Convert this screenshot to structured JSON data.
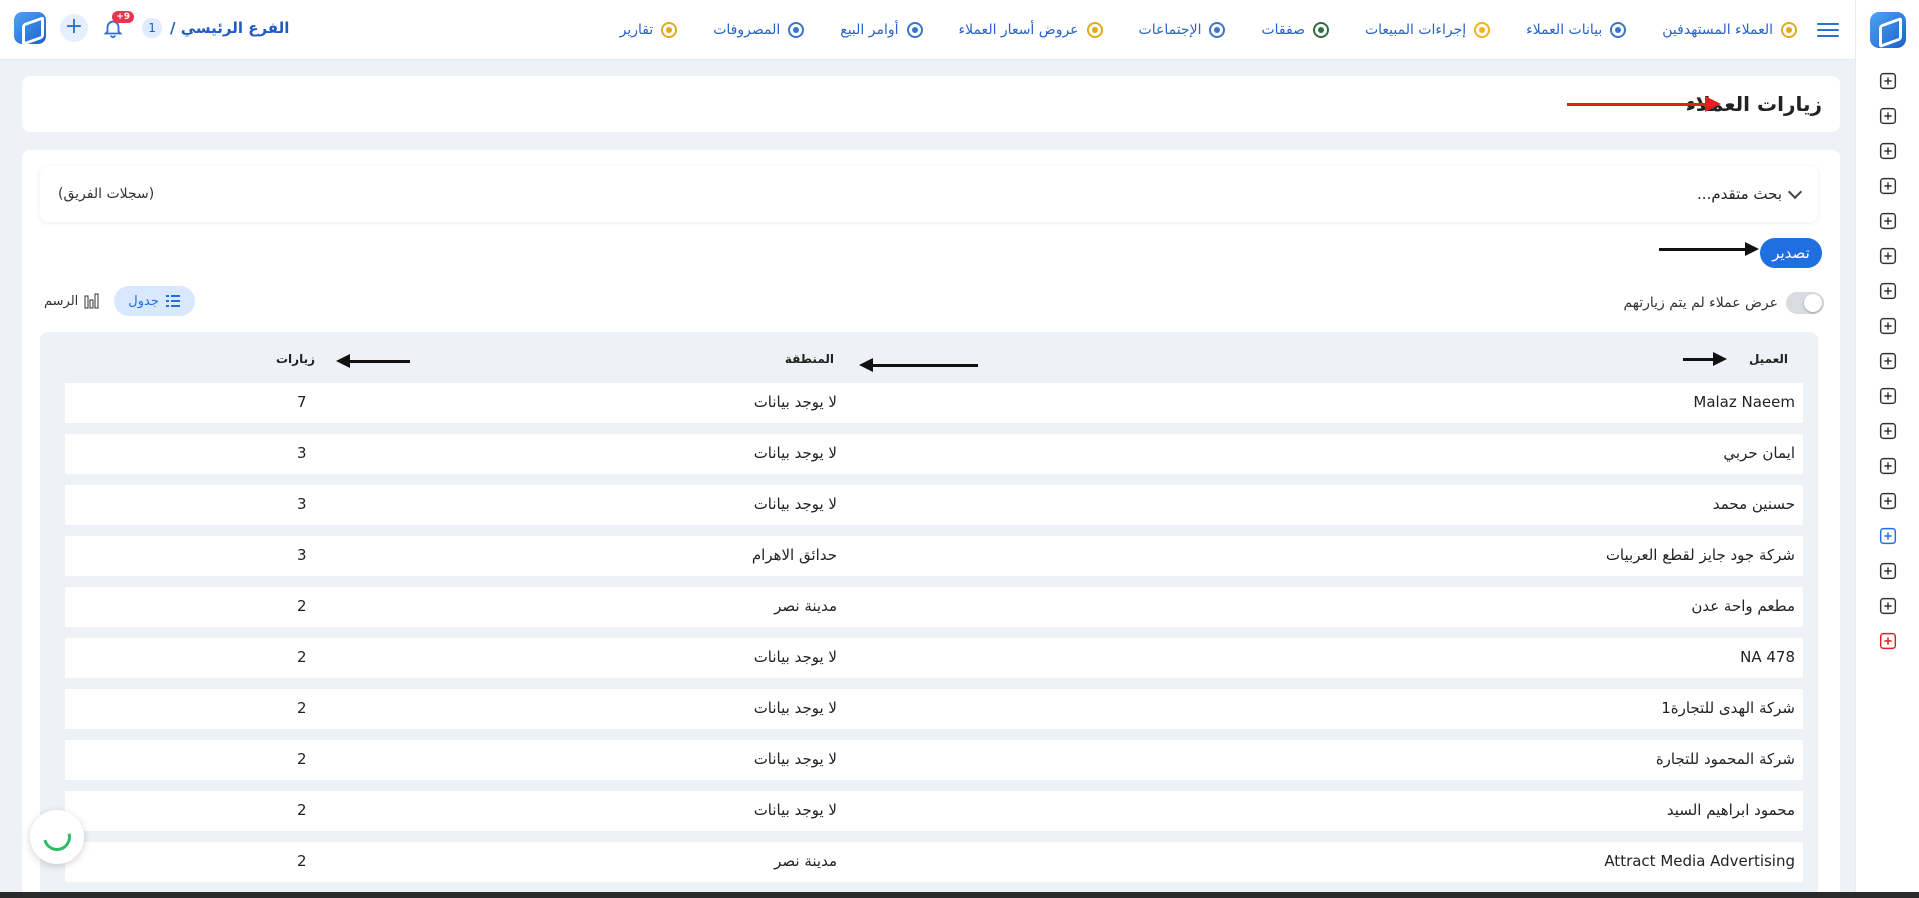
{
  "topbar": {
    "branch_number": "1",
    "branch_name": "الفرع الرئيسي /",
    "notifications_badge": "+9",
    "nav": [
      {
        "label": "العملاء المستهدفين",
        "icon": "target-clients-icon",
        "color": "#e3a91d"
      },
      {
        "label": "بيانات العملاء",
        "icon": "client-data-icon",
        "color": "#3b74c9"
      },
      {
        "label": "إجراءات المبيعات",
        "icon": "sales-procedures-icon",
        "color": "#f1b21a"
      },
      {
        "label": "صفقات",
        "icon": "deals-icon",
        "color": "#2f6f3f"
      },
      {
        "label": "الإجتماعات",
        "icon": "meetings-icon",
        "color": "#3b74c9"
      },
      {
        "label": "عروض أسعار العملاء",
        "icon": "quotes-icon",
        "color": "#e3a91d"
      },
      {
        "label": "أوامر البيع",
        "icon": "sales-orders-icon",
        "color": "#3b74c9"
      },
      {
        "label": "المصروفات",
        "icon": "expenses-icon",
        "color": "#3b74c9"
      },
      {
        "label": "تقارير",
        "icon": "reports-icon",
        "color": "#e3a91d"
      }
    ]
  },
  "page": {
    "title": "زيارات العملاء"
  },
  "search": {
    "advanced_label": "بحث متقدم...",
    "team_records": "(سجلات الفريق)"
  },
  "toolbar": {
    "export_label": "تصدير",
    "toggle_label": "عرض عملاء لم يتم زيارتهم",
    "view_table": "جدول",
    "view_chart": "الرسم"
  },
  "table": {
    "headers": {
      "client": "العميل",
      "region": "المنطقة",
      "visits": "زيارات"
    },
    "rows": [
      {
        "client": "Malaz Naeem",
        "region": "لا يوجد بيانات",
        "visits": "7"
      },
      {
        "client": "ايمان حربي",
        "region": "لا يوجد بيانات",
        "visits": "3"
      },
      {
        "client": "حسنين محمد",
        "region": "لا يوجد بيانات",
        "visits": "3"
      },
      {
        "client": "شركة جود جايز لقطع العربيات",
        "region": "حدائق الاهرام",
        "visits": "3"
      },
      {
        "client": "مطعم واحة عدن",
        "region": "مدينة نصر",
        "visits": "2"
      },
      {
        "client": "NA 478",
        "region": "لا يوجد بيانات",
        "visits": "2"
      },
      {
        "client": "شركة الهدى للتجارة1",
        "region": "لا يوجد بيانات",
        "visits": "2"
      },
      {
        "client": "شركة المحمود للتجارة",
        "region": "لا يوجد بيانات",
        "visits": "2"
      },
      {
        "client": "محمود ابراهيم السيد",
        "region": "لا يوجد بيانات",
        "visits": "2"
      },
      {
        "client": "Attract Media Advertising",
        "region": "مدينة نصر",
        "visits": "2"
      }
    ]
  },
  "colors": {
    "primary": "#1f6fe0",
    "nav_text": "#2962c9",
    "annotation_red": "#e01f1f",
    "annotation_black": "#111111"
  },
  "sidebar_icons": [
    "add-file-icon",
    "teams-icon",
    "money-icon",
    "warning-icon",
    "video-icon",
    "tent-icon",
    "invoice-icon",
    "edit-pen-icon",
    "shipping-icon",
    "delivery-icon",
    "user-settings-icon",
    "add-document-icon",
    "refresh-document-icon",
    "analytics-icon",
    "settings-icon",
    "window-icon",
    "power-icon"
  ]
}
